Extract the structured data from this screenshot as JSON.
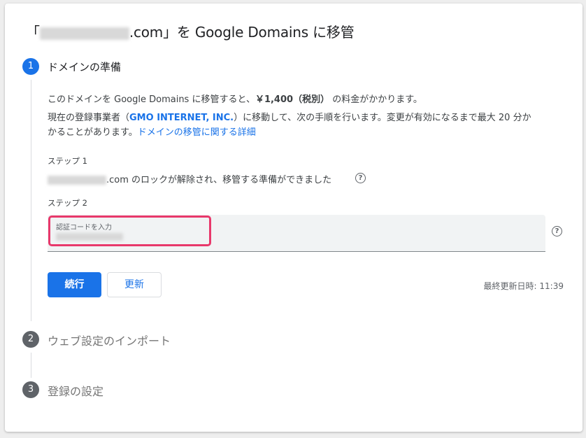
{
  "title": {
    "open_bracket": "「",
    "domain_suffix": ".com",
    "close_text": "」を Google Domains に移管"
  },
  "steps": [
    {
      "number": "1",
      "label": "ドメインの準備",
      "state": "active"
    },
    {
      "number": "2",
      "label": "ウェブ設定のインポート",
      "state": "inactive"
    },
    {
      "number": "3",
      "label": "登録の設定",
      "state": "inactive"
    }
  ],
  "step1": {
    "line1_prefix": "このドメインを Google Domains に移管すると、",
    "price": "￥1,400（税別）",
    "line1_suffix": " の料金がかかります。",
    "line2_prefix": "現在の登録事業者（",
    "registrar": "GMO INTERNET, INC.",
    "line2_suffix": "）に移動して、次の手順を行います。変更が有効になるまで最大 20 分か",
    "line3_prefix": "かることがあります。",
    "details_link": "ドメインの移管に関する詳細",
    "substep1_label": "ステップ 1",
    "substep1_domain_suffix": ".com",
    "substep1_text": " のロックが解除され、移管する準備ができました",
    "substep2_label": "ステップ 2",
    "auth_code_label": "認証コードを入力",
    "continue_button": "続行",
    "refresh_button": "更新",
    "last_updated": "最終更新日時: 11:39"
  },
  "colors": {
    "accent": "#1a73e8",
    "highlight": "#e8386b",
    "inactive_step": "#5f6368"
  }
}
